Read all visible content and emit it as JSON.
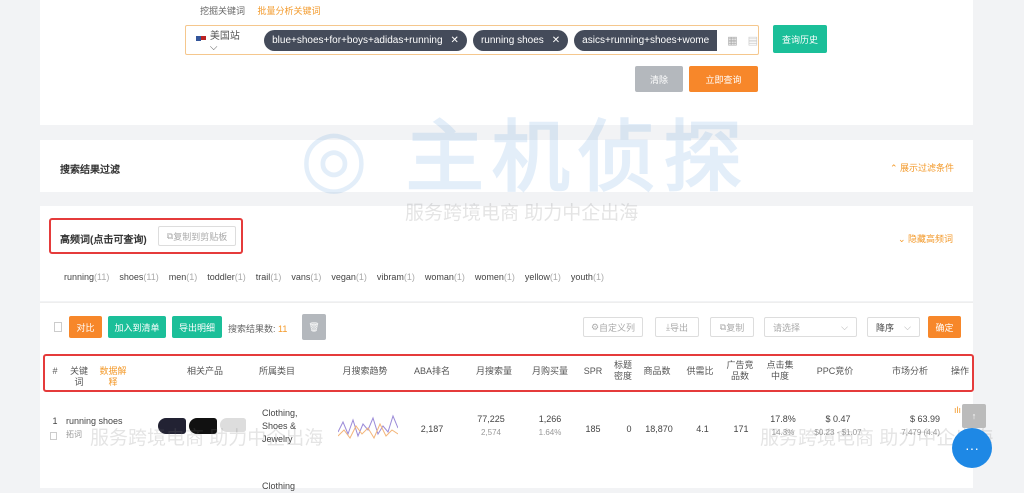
{
  "tabs": [
    "挖掘关键词",
    "批量分析关键词"
  ],
  "search": {
    "site": "美国站",
    "chips": [
      "blue+shoes+for+boys+adidas+running",
      "running shoes",
      "asics+running+shoes+wome"
    ]
  },
  "buttons": {
    "history": "查询历史",
    "clear": "清除",
    "query": "立即查询"
  },
  "filter": {
    "title": "搜索结果过滤",
    "toggle": "展示过滤条件"
  },
  "freq": {
    "title": "高频词(点击可查询)",
    "copy": "复制到剪贴板",
    "toggle": "隐藏高频词",
    "words": [
      {
        "w": "running",
        "c": "(11)"
      },
      {
        "w": "shoes",
        "c": "(11)"
      },
      {
        "w": "men",
        "c": "(1)"
      },
      {
        "w": "toddler",
        "c": "(1)"
      },
      {
        "w": "trail",
        "c": "(1)"
      },
      {
        "w": "vans",
        "c": "(1)"
      },
      {
        "w": "vegan",
        "c": "(1)"
      },
      {
        "w": "vibram",
        "c": "(1)"
      },
      {
        "w": "woman",
        "c": "(1)"
      },
      {
        "w": "women",
        "c": "(1)"
      },
      {
        "w": "yellow",
        "c": "(1)"
      },
      {
        "w": "youth",
        "c": "(1)"
      }
    ]
  },
  "toolbar": {
    "compare": "对比",
    "add_list": "加入到清单",
    "export_detail": "导出明细",
    "result_label": "搜索结果数:",
    "result_count": "11",
    "custom_cols": "自定义列",
    "export": "导出",
    "copy": "复制",
    "select_placeholder": "请选择",
    "sort": "降序",
    "confirm": "确定"
  },
  "table": {
    "headers": [
      "#",
      "关键词",
      "数据解释",
      "相关产品",
      "所属类目",
      "月搜索趋势",
      "ABA排名",
      "月搜索量",
      "月购买量",
      "SPR",
      "标题密度",
      "商品数",
      "供需比",
      "广告竞品数",
      "点击集中度",
      "PPC竞价",
      "市场分析",
      "操作"
    ],
    "rows": [
      {
        "idx": "1",
        "keyword": "running shoes",
        "keyword_sub": "拓词",
        "category": "Clothing, Shoes & Jewelry",
        "aba": "2,187",
        "search": "77,225",
        "search_sub": "2,574",
        "buy": "1,266",
        "buy_sub": "1.64%",
        "spr": "185",
        "density": "0",
        "products": "18,870",
        "ratio": "4.1",
        "ads": "171",
        "click": "17.8%",
        "click_sub": "14.3%",
        "ppc": "$ 0.47",
        "ppc_sub": "$0.23 - $1.07",
        "market": "$ 63.99",
        "market_sub": "7,479 (4.4)"
      }
    ],
    "next_row_category": "Clothing"
  },
  "watermark": {
    "logo": "主机侦探",
    "slogan": "服务跨境电商 助力中企出海"
  },
  "colors": {
    "orange": "#f39a2b",
    "green": "#1bbf99",
    "red_box": "#e53b3b",
    "chip": "#444b5a",
    "chat": "#1e88e5"
  }
}
